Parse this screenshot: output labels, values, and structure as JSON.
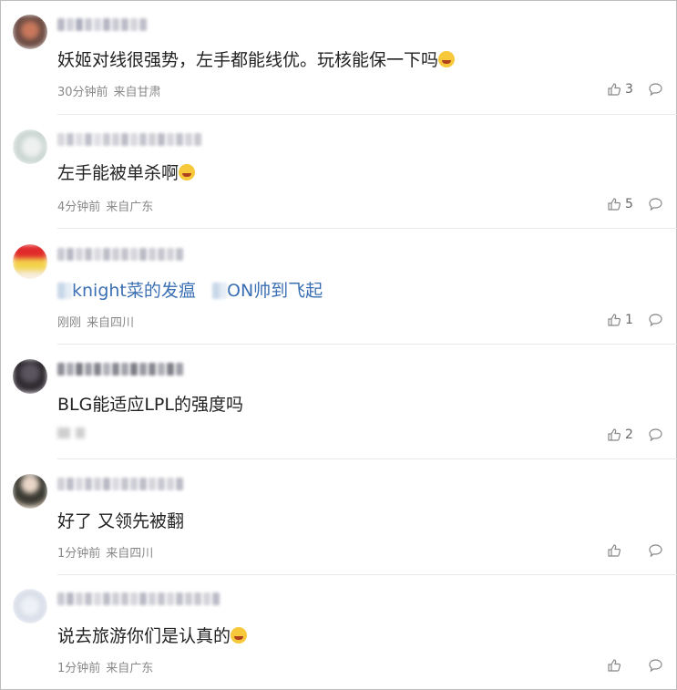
{
  "comments": [
    {
      "text": "妖姬对线很强势，左手都能线优。玩核能保一下吗",
      "emoji": "crying-laughing-emoji",
      "meta_time": "30分钟前",
      "meta_loc": "来自甘肃",
      "likes": "3"
    },
    {
      "text": "左手能被单杀啊",
      "emoji": "smile-emoji",
      "meta_time": "4分钟前",
      "meta_loc": "来自广东",
      "likes": "5"
    },
    {
      "text_part1": "knight菜的发瘟",
      "text_part2": "ON帅到飞起",
      "meta_time": "刚刚",
      "meta_loc": "来自四川",
      "likes": "1"
    },
    {
      "text": "BLG能适应LPL的强度吗",
      "likes": "2"
    },
    {
      "text": "好了 又领先被翻",
      "meta_time": "1分钟前",
      "meta_loc": "来自四川"
    },
    {
      "text": "说去旅游你们是认真的",
      "emoji": "grin-emoji",
      "meta_time": "1分钟前",
      "meta_loc": "来自广东"
    }
  ],
  "colors": {
    "text": "#222222",
    "meta": "#888888",
    "link": "#3b6fb3",
    "divider": "#e9e9e9"
  }
}
